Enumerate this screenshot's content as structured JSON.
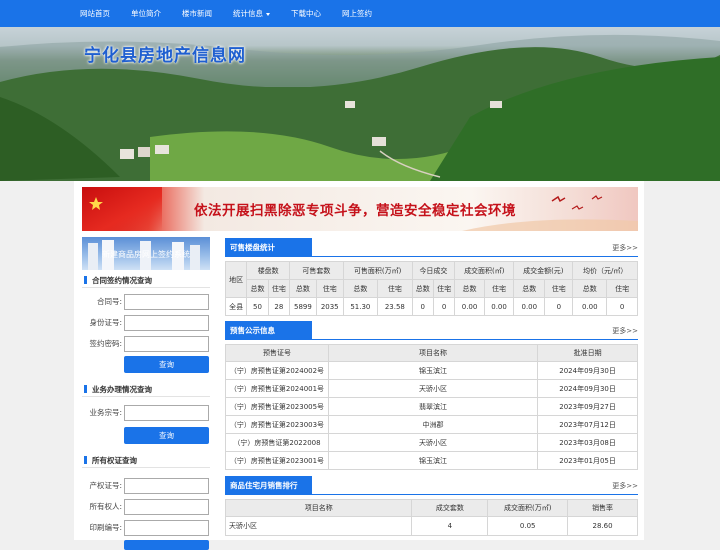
{
  "nav": {
    "items": [
      "网站首页",
      "单位简介",
      "楼市新闻",
      "统计信息",
      "下载中心",
      "网上签约"
    ]
  },
  "banner": {
    "title": "宁化县房地产信息网"
  },
  "slogan": {
    "text": "依法开展扫黑除恶专项斗争，营造安全稳定社会环境"
  },
  "sidebar": {
    "banner_label": "新建商品房网上签约系统",
    "contract_query": {
      "heading": "合同签约情况查询",
      "fields": [
        {
          "label": "合同号:",
          "value": ""
        },
        {
          "label": "身份证号:",
          "value": ""
        },
        {
          "label": "签约密码:",
          "value": ""
        }
      ],
      "button": "查询"
    },
    "business_query": {
      "heading": "业务办理情况查询",
      "fields": [
        {
          "label": "业务宗号:",
          "value": ""
        }
      ],
      "button": "查询"
    },
    "ownership_query": {
      "heading": "所有权证查询",
      "fields": [
        {
          "label": "产权证号:",
          "value": ""
        },
        {
          "label": "所有权人:",
          "value": ""
        },
        {
          "label": "印刷编号:",
          "value": ""
        }
      ]
    }
  },
  "sales_stats": {
    "tab": "可售楼盘统计",
    "more": "更多>>",
    "headers": [
      "地区",
      "楼盘数",
      "可售套数",
      "可售面积(万㎡)",
      "今日成交",
      "成交面积(㎡)",
      "成交金额(元)",
      "均价（元/㎡）"
    ],
    "subheaders": [
      "总数",
      "住宅",
      "总数",
      "住宅",
      "总数",
      "住宅",
      "总数",
      "住宅",
      "总数",
      "住宅",
      "总数",
      "住宅",
      "总数",
      "住宅"
    ],
    "rows": [
      [
        "全县",
        "50",
        "28",
        "5899",
        "2035",
        "51.30",
        "23.58",
        "0",
        "0",
        "0.00",
        "0.00",
        "0.00",
        "0",
        "0.00",
        "0"
      ]
    ]
  },
  "presale": {
    "tab": "预售公示信息",
    "more": "更多>>",
    "headers": [
      "预售证号",
      "项目名称",
      "批准日期"
    ],
    "rows": [
      [
        "（宁）房预售证第2024002号",
        "锦玉滨江",
        "2024年09月30日"
      ],
      [
        "（宁）房预售证第2024001号",
        "天骄小区",
        "2024年09月30日"
      ],
      [
        "（宁）房预售证第2023005号",
        "翡翠滨江",
        "2023年09月27日"
      ],
      [
        "（宁）房预售证第2023003号",
        "中洲郡",
        "2023年07月12日"
      ],
      [
        "（宁）房预售证第2022008",
        "天骄小区",
        "2023年03月08日"
      ],
      [
        "（宁）房预售证第2023001号",
        "锦玉滨江",
        "2023年01月05日"
      ]
    ]
  },
  "ranking": {
    "tab": "商品住宅月销售排行",
    "more": "更多>>",
    "headers": [
      "项目名称",
      "成交套数",
      "成交面积(万㎡)",
      "销售率"
    ],
    "rows": [
      [
        "天骄小区",
        "4",
        "0.05",
        "28.60"
      ]
    ]
  }
}
